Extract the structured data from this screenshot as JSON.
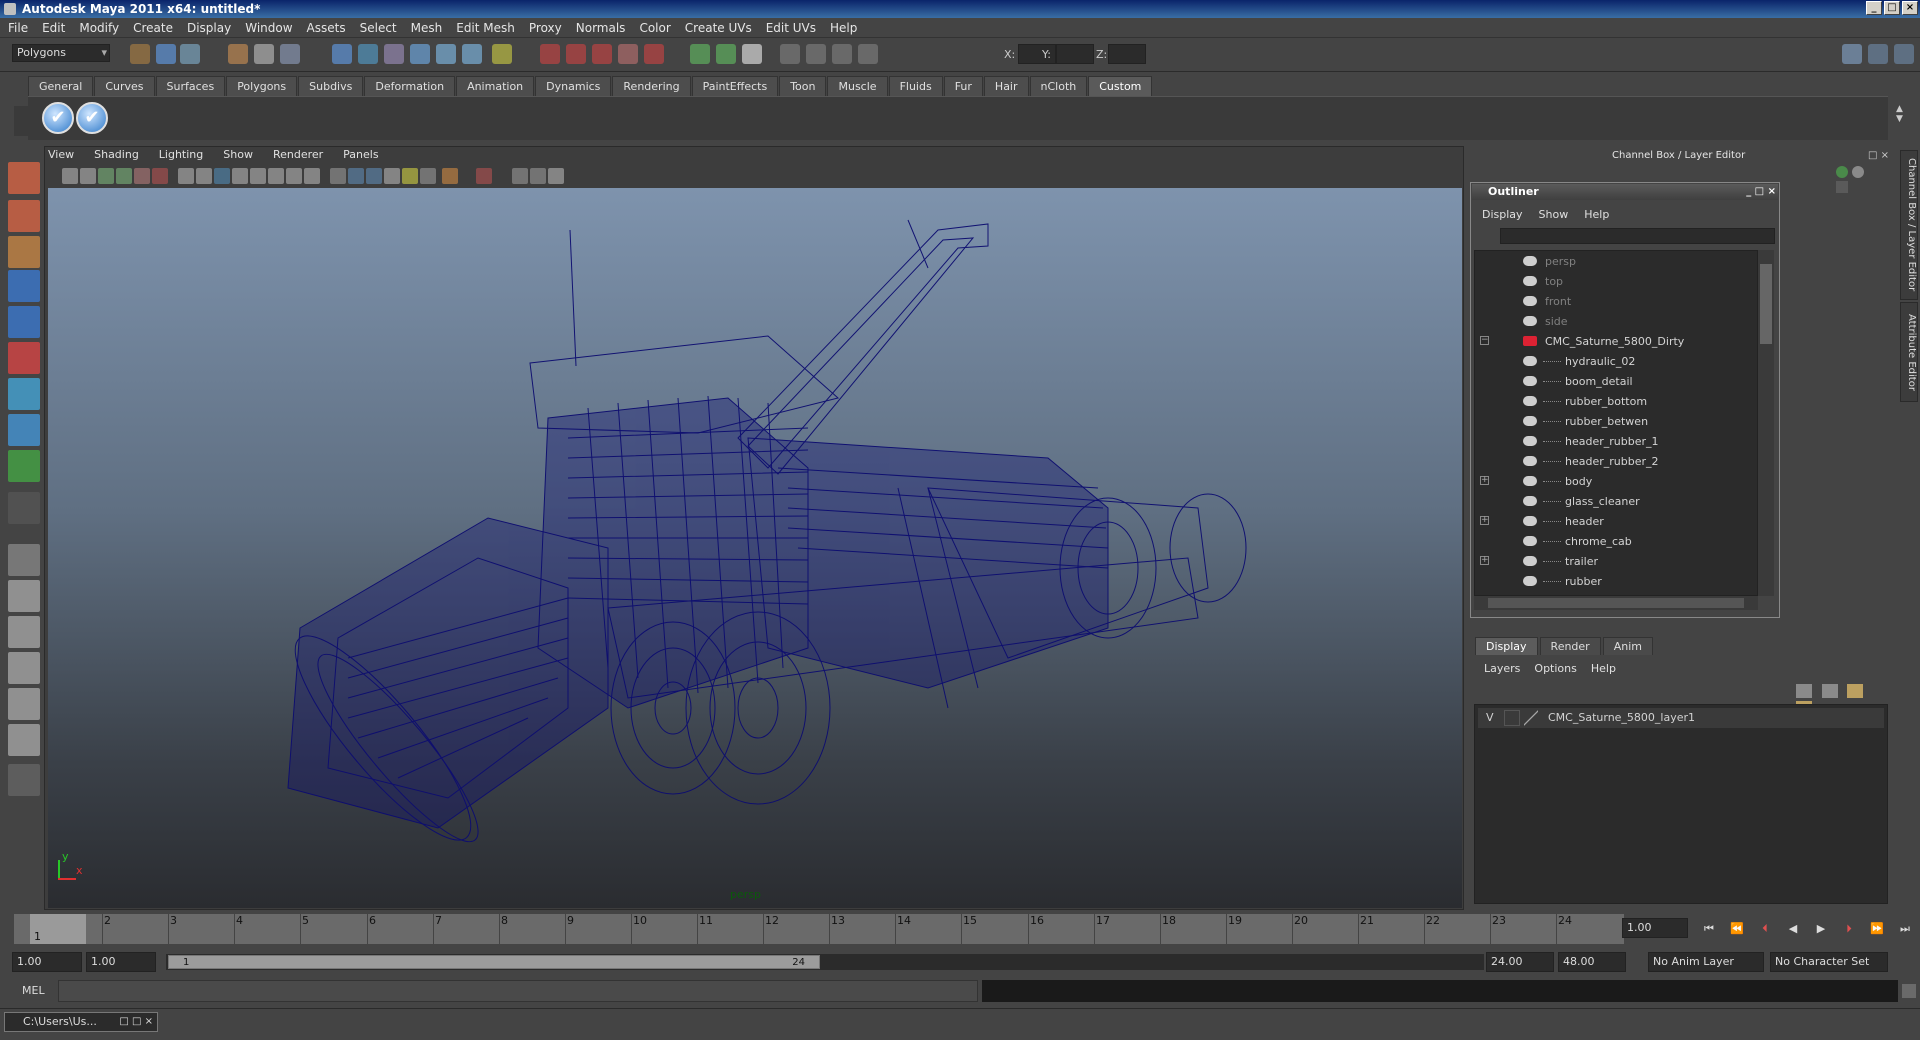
{
  "window": {
    "title": "Autodesk Maya 2011 x64: untitled*",
    "controls": [
      "_",
      "□",
      "×"
    ]
  },
  "menubar": [
    "File",
    "Edit",
    "Modify",
    "Create",
    "Display",
    "Window",
    "Assets",
    "Select",
    "Mesh",
    "Edit Mesh",
    "Proxy",
    "Normals",
    "Color",
    "Create UVs",
    "Edit UVs",
    "Help"
  ],
  "statusline": {
    "mode": "Polygons",
    "x_label": "X:",
    "y_label": "Y:",
    "z_label": "Z:"
  },
  "shelf": {
    "tabs": [
      "General",
      "Curves",
      "Surfaces",
      "Polygons",
      "Subdivs",
      "Deformation",
      "Animation",
      "Dynamics",
      "Rendering",
      "PaintEffects",
      "Toon",
      "Muscle",
      "Fluids",
      "Fur",
      "Hair",
      "nCloth",
      "Custom"
    ],
    "active_tab": "Custom"
  },
  "viewport": {
    "menu": [
      "View",
      "Shading",
      "Lighting",
      "Show",
      "Renderer",
      "Panels"
    ],
    "camera_label": "persp",
    "axis_x": "x",
    "axis_y": "y"
  },
  "channel_box": {
    "title": "Channel Box / Layer Editor"
  },
  "side_tabs": {
    "channel": "Channel Box / Layer Editor",
    "attribute": "Attribute Editor"
  },
  "outliner": {
    "title": "Outliner",
    "menu": [
      "Display",
      "Show",
      "Help"
    ],
    "items": [
      {
        "label": "persp",
        "level": 0,
        "greyed": true,
        "expander": ""
      },
      {
        "label": "top",
        "level": 0,
        "greyed": true,
        "expander": ""
      },
      {
        "label": "front",
        "level": 0,
        "greyed": true,
        "expander": ""
      },
      {
        "label": "side",
        "level": 0,
        "greyed": true,
        "expander": ""
      },
      {
        "label": "CMC_Saturne_5800_Dirty",
        "level": 0,
        "greyed": false,
        "expander": "−"
      },
      {
        "label": "hydraulic_02",
        "level": 1,
        "greyed": false,
        "expander": ""
      },
      {
        "label": "boom_detail",
        "level": 1,
        "greyed": false,
        "expander": ""
      },
      {
        "label": "rubber_bottom",
        "level": 1,
        "greyed": false,
        "expander": ""
      },
      {
        "label": "rubber_betwen",
        "level": 1,
        "greyed": false,
        "expander": ""
      },
      {
        "label": "header_rubber_1",
        "level": 1,
        "greyed": false,
        "expander": ""
      },
      {
        "label": "header_rubber_2",
        "level": 1,
        "greyed": false,
        "expander": ""
      },
      {
        "label": "body",
        "level": 1,
        "greyed": false,
        "expander": "+"
      },
      {
        "label": "glass_cleaner",
        "level": 1,
        "greyed": false,
        "expander": ""
      },
      {
        "label": "header",
        "level": 1,
        "greyed": false,
        "expander": "+"
      },
      {
        "label": "chrome_cab",
        "level": 1,
        "greyed": false,
        "expander": ""
      },
      {
        "label": "trailer",
        "level": 1,
        "greyed": false,
        "expander": "+"
      },
      {
        "label": "rubber",
        "level": 1,
        "greyed": false,
        "expander": ""
      }
    ]
  },
  "layer_editor": {
    "tabs": [
      "Display",
      "Render",
      "Anim"
    ],
    "active_tab": "Display",
    "menu": [
      "Layers",
      "Options",
      "Help"
    ],
    "layers": [
      {
        "visible": "V",
        "name": "CMC_Saturne_5800_layer1"
      }
    ]
  },
  "timeline": {
    "ticks": [
      "1",
      "2",
      "3",
      "4",
      "5",
      "6",
      "7",
      "8",
      "9",
      "10",
      "11",
      "12",
      "13",
      "14",
      "15",
      "16",
      "17",
      "18",
      "19",
      "20",
      "21",
      "22",
      "23",
      "24"
    ],
    "current_frame_marker": "1",
    "current_time": "1.00"
  },
  "range": {
    "start": "1.00",
    "playback_start": "1.00",
    "handle_start": "1",
    "handle_end": "24",
    "playback_end": "24.00",
    "end": "48.00",
    "anim_layer": "No Anim Layer",
    "character_set": "No Character Set"
  },
  "commandline": {
    "label": "MEL"
  },
  "taskbar": {
    "item": "C:\\Users\\Us..."
  },
  "colors": {
    "wireframe": "#0d0d70",
    "viewport_top": "#7e93ad",
    "viewport_bottom": "#2a2c30",
    "panel": "#444444",
    "titlebar": "#0a246a"
  }
}
